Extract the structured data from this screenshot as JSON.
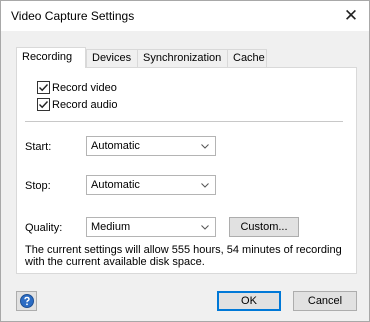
{
  "window": {
    "title": "Video Capture Settings",
    "close_glyph": "✕"
  },
  "tabs": [
    {
      "label": "Recording",
      "active": true
    },
    {
      "label": "Devices",
      "active": false
    },
    {
      "label": "Synchronization",
      "active": false
    },
    {
      "label": "Cache",
      "active": false
    }
  ],
  "recording": {
    "record_video": {
      "label": "Record video",
      "checked": true
    },
    "record_audio": {
      "label": "Record audio",
      "checked": true
    },
    "start": {
      "label": "Start:",
      "value": "Automatic"
    },
    "stop": {
      "label": "Stop:",
      "value": "Automatic"
    },
    "quality": {
      "label": "Quality:",
      "value": "Medium",
      "custom_button": "Custom..."
    },
    "info": "The current settings will allow 555 hours, 54 minutes of recording with the current available disk space."
  },
  "footer": {
    "ok_label": "OK",
    "cancel_label": "Cancel",
    "help_icon": "help-question-icon"
  },
  "colors": {
    "accent": "#0078d7",
    "help_blue": "#2b6cc4"
  }
}
